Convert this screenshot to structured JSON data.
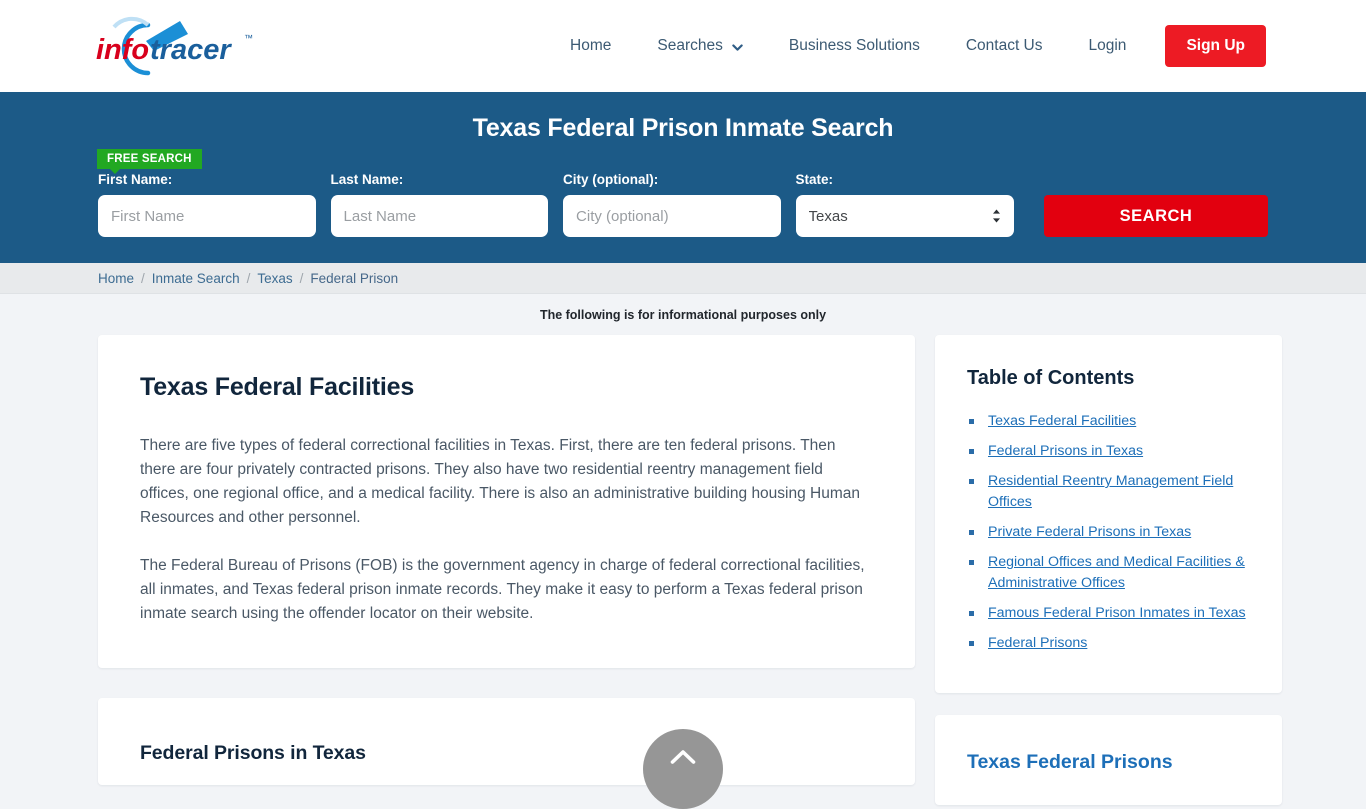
{
  "header": {
    "logo": {
      "text_primary": "info",
      "text_secondary": "tracer",
      "trademark": "™"
    },
    "nav": [
      {
        "label": "Home",
        "has_dropdown": false
      },
      {
        "label": "Searches",
        "has_dropdown": true
      },
      {
        "label": "Business Solutions",
        "has_dropdown": false
      },
      {
        "label": "Contact Us",
        "has_dropdown": false
      },
      {
        "label": "Login",
        "has_dropdown": false
      }
    ],
    "signup_label": "Sign Up"
  },
  "banner": {
    "title": "Texas Federal Prison Inmate Search",
    "free_badge": "FREE SEARCH",
    "fields": {
      "first_name": {
        "label": "First Name:",
        "placeholder": "First Name",
        "value": ""
      },
      "last_name": {
        "label": "Last Name:",
        "placeholder": "Last Name",
        "value": ""
      },
      "city": {
        "label": "City (optional):",
        "placeholder": "City (optional)",
        "value": ""
      },
      "state": {
        "label": "State:",
        "selected": "Texas"
      }
    },
    "search_button": "SEARCH",
    "accent_blue": "#1c5a87",
    "accent_red": "#e2000f",
    "accent_green": "#22a822"
  },
  "breadcrumb": [
    {
      "label": "Home"
    },
    {
      "label": "Inmate Search"
    },
    {
      "label": "Texas"
    },
    {
      "label": "Federal Prison"
    }
  ],
  "breadcrumb_separator": "/",
  "notice": "The following is for informational purposes only",
  "main": {
    "section1_title": "Texas Federal Facilities",
    "paragraph1": "There are five types of federal correctional facilities in Texas. First, there are ten federal prisons. Then there are four privately contracted prisons. They also have two residential reentry management field offices, one regional office, and a medical facility. There is also an administrative building housing Human Resources and other personnel.",
    "paragraph2": "The Federal Bureau of Prisons (FOB) is the government agency in charge of federal correctional facilities, all inmates, and Texas federal prison inmate records. They make it easy to perform a Texas federal prison inmate search using the offender locator on their website.",
    "section2_title": "Federal Prisons in Texas"
  },
  "sidebar": {
    "toc_title": "Table of Contents",
    "toc_items": [
      {
        "label": "Texas Federal Facilities"
      },
      {
        "label": "Federal Prisons in Texas"
      },
      {
        "label": "Residential Reentry Management Field Offices"
      },
      {
        "label": "Private Federal Prisons in Texas"
      },
      {
        "label": "Regional Offices and Medical Facilities & Administrative Offices"
      },
      {
        "label": "Famous Federal Prison Inmates in Texas"
      },
      {
        "label": "Federal Prisons"
      }
    ],
    "card2_title": "Texas Federal Prisons"
  },
  "scroll_top": {
    "icon": "chevron-up-icon"
  }
}
